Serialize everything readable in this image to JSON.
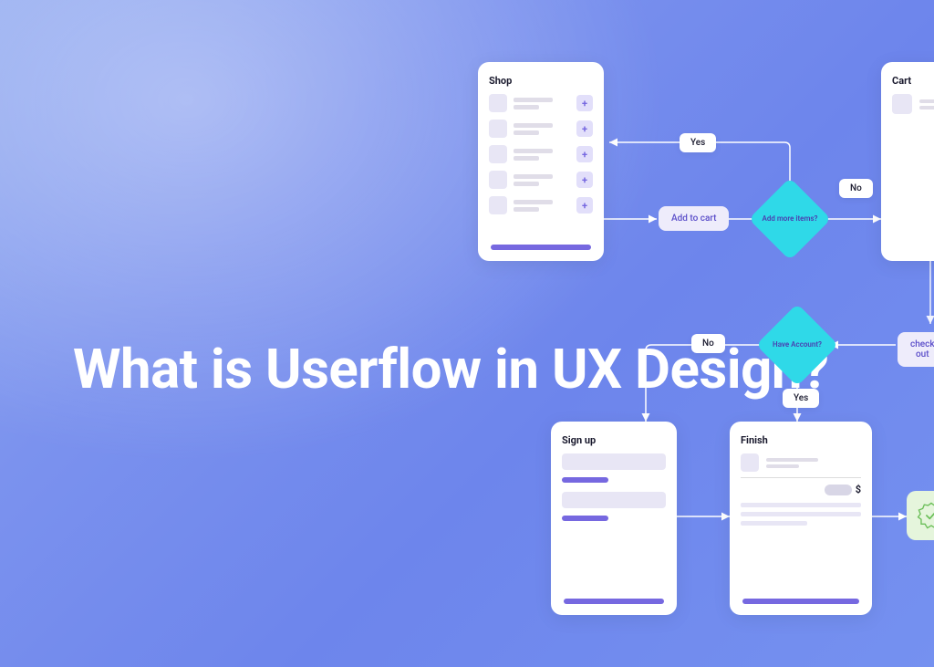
{
  "title": "What is Userflow in UX Design?",
  "cards": {
    "shop": {
      "title": "Shop"
    },
    "cart": {
      "title": "Cart"
    },
    "signup": {
      "title": "Sign up"
    },
    "finish": {
      "title": "Finish",
      "currency": "$"
    }
  },
  "nodes": {
    "addToCart": "Add to cart",
    "addMore": "Add more items?",
    "checkout": "check out",
    "haveAccount": "Have Account?"
  },
  "labels": {
    "yes": "Yes",
    "no": "No"
  }
}
